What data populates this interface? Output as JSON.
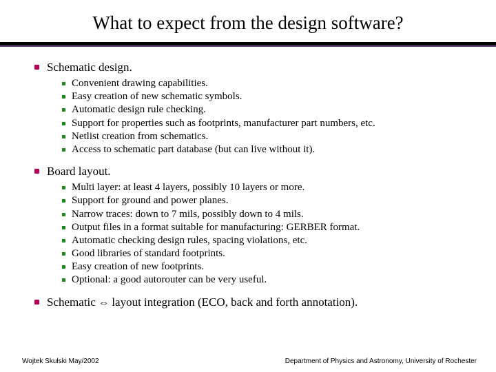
{
  "title": "What to expect from the design software?",
  "sections": [
    {
      "heading": "Schematic design.",
      "items": [
        "Convenient drawing capabilities.",
        "Easy creation of new schematic symbols.",
        "Automatic design rule checking.",
        "Support for properties such as footprints, manufacturer part numbers, etc.",
        "Netlist creation from schematics.",
        "Access to schematic part database (but can live without it)."
      ]
    },
    {
      "heading": "Board layout.",
      "items": [
        "Multi layer: at least 4 layers, possibly 10 layers or more.",
        "Support for ground and power planes.",
        "Narrow traces: down to 7 mils, possibly down to 4 mils.",
        "Output files in a format suitable for manufacturing: GERBER format.",
        "Automatic checking design rules, spacing violations, etc.",
        "Good libraries of standard footprints.",
        "Easy creation of new footprints.",
        "Optional: a good autorouter can be very useful."
      ]
    },
    {
      "heading_pre": "Schematic ",
      "heading_arrow": "⇔",
      "heading_post": " layout integration (ECO, back and forth annotation).",
      "items": []
    }
  ],
  "footer": {
    "left": "Wojtek Skulski May/2002",
    "right": "Department of Physics and Astronomy, University of Rochester"
  }
}
